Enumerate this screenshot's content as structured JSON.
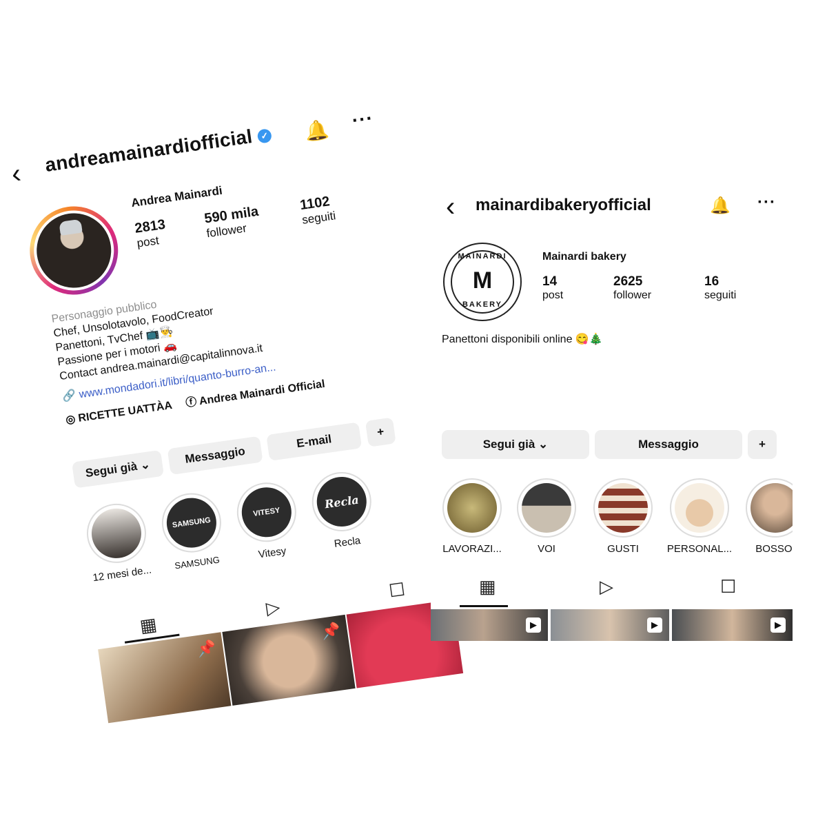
{
  "left_profile": {
    "username": "andreamainardiofficial",
    "display_name": "Andrea Mainardi",
    "stats": [
      {
        "number": "2813",
        "label": "post"
      },
      {
        "number": "590 mila",
        "label": "follower"
      },
      {
        "number": "1102",
        "label": "seguiti"
      }
    ],
    "category": "Personaggio pubblico",
    "bio_lines": [
      "Chef, Unsolotavolo, FoodCreator",
      "Panettoni, TvChef 📺👨‍🍳",
      "Passione per i motori 🚗",
      "Contact andrea.mainardi@capitalinnova.it"
    ],
    "link": "www.mondadori.it/libri/quanto-burro-an...",
    "facebook_link": "Andrea Mainardi Official",
    "channel": "RICETTE UATTÀA",
    "buttons": {
      "follow": "Segui già",
      "message": "Messaggio",
      "email": "E-mail"
    },
    "highlights": [
      {
        "label": "12 mesi de...",
        "inner": ""
      },
      {
        "label": "SAMSUNG",
        "inner": "SAMSUNG"
      },
      {
        "label": "Vitesy",
        "inner": "VITESY"
      },
      {
        "label": "Recla",
        "inner": "Recla"
      }
    ]
  },
  "right_profile": {
    "username": "mainardibakeryofficial",
    "display_name": "Mainardi bakery",
    "logo_top": "MAINARDI",
    "logo_mid": "M",
    "logo_bottom": "BAKERY",
    "stats": [
      {
        "number": "14",
        "label": "post"
      },
      {
        "number": "2625",
        "label": "follower"
      },
      {
        "number": "16",
        "label": "seguiti"
      }
    ],
    "bio": "Panettoni disponibili online 😋🎄",
    "buttons": {
      "follow": "Segui già",
      "message": "Messaggio"
    },
    "highlights": [
      {
        "label": "LAVORAZI..."
      },
      {
        "label": "VOI"
      },
      {
        "label": "GUSTI"
      },
      {
        "label": "PERSONAL..."
      },
      {
        "label": "BOSSOI"
      }
    ]
  },
  "colors": {
    "verified": "#3897f0",
    "link": "#3b5ec7",
    "button_bg": "#efefef"
  }
}
